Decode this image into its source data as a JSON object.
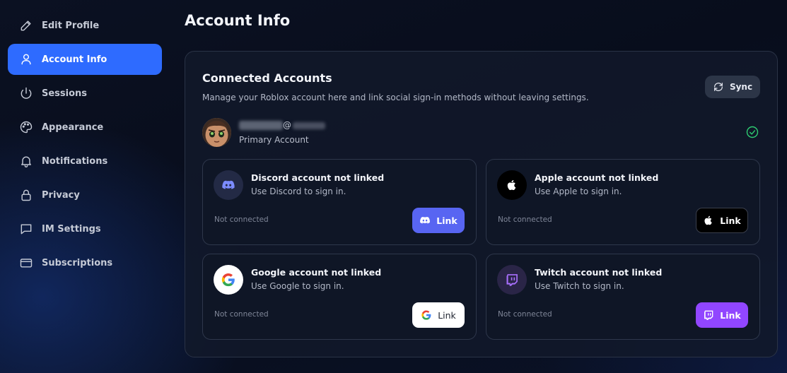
{
  "sidebar": {
    "items": [
      {
        "label": "Edit Profile",
        "icon": "pencil-icon",
        "active": false
      },
      {
        "label": "Account Info",
        "icon": "user-icon",
        "active": true
      },
      {
        "label": "Sessions",
        "icon": "power-icon",
        "active": false
      },
      {
        "label": "Appearance",
        "icon": "palette-icon",
        "active": false
      },
      {
        "label": "Notifications",
        "icon": "bell-icon",
        "active": false
      },
      {
        "label": "Privacy",
        "icon": "lock-icon",
        "active": false
      },
      {
        "label": "IM Settings",
        "icon": "chat-icon",
        "active": false
      },
      {
        "label": "Subscriptions",
        "icon": "card-icon",
        "active": false
      }
    ]
  },
  "main": {
    "title": "Account Info",
    "panel": {
      "title": "Connected Accounts",
      "subtitle": "Manage your Roblox account here and link social sign-in methods without leaving settings.",
      "sync_label": "Sync",
      "account": {
        "at_sign": "@",
        "primary_label": "Primary Account"
      },
      "cards": [
        {
          "name": "discord",
          "title": "Discord account not linked",
          "desc": "Use Discord to sign in.",
          "status": "Not connected",
          "button": "Link",
          "button_bg": "#5865f2",
          "button_fg": "#ffffff",
          "logo_bg": "#232a45"
        },
        {
          "name": "apple",
          "title": "Apple account not linked",
          "desc": "Use Apple to sign in.",
          "status": "Not connected",
          "button": "Link",
          "button_bg": "#000000",
          "button_fg": "#ffffff",
          "logo_bg": "#000000"
        },
        {
          "name": "google",
          "title": "Google account not linked",
          "desc": "Use Google to sign in.",
          "status": "Not connected",
          "button": "Link",
          "button_bg": "#ffffff",
          "button_fg": "#1f2430",
          "logo_bg": "#ffffff"
        },
        {
          "name": "twitch",
          "title": "Twitch account not linked",
          "desc": "Use Twitch to sign in.",
          "status": "Not connected",
          "button": "Link",
          "button_bg": "#9146ff",
          "button_fg": "#ffffff",
          "logo_bg": "#2a2547"
        }
      ]
    }
  },
  "colors": {
    "accent": "#2e6bff",
    "verified": "#2ecc71"
  }
}
